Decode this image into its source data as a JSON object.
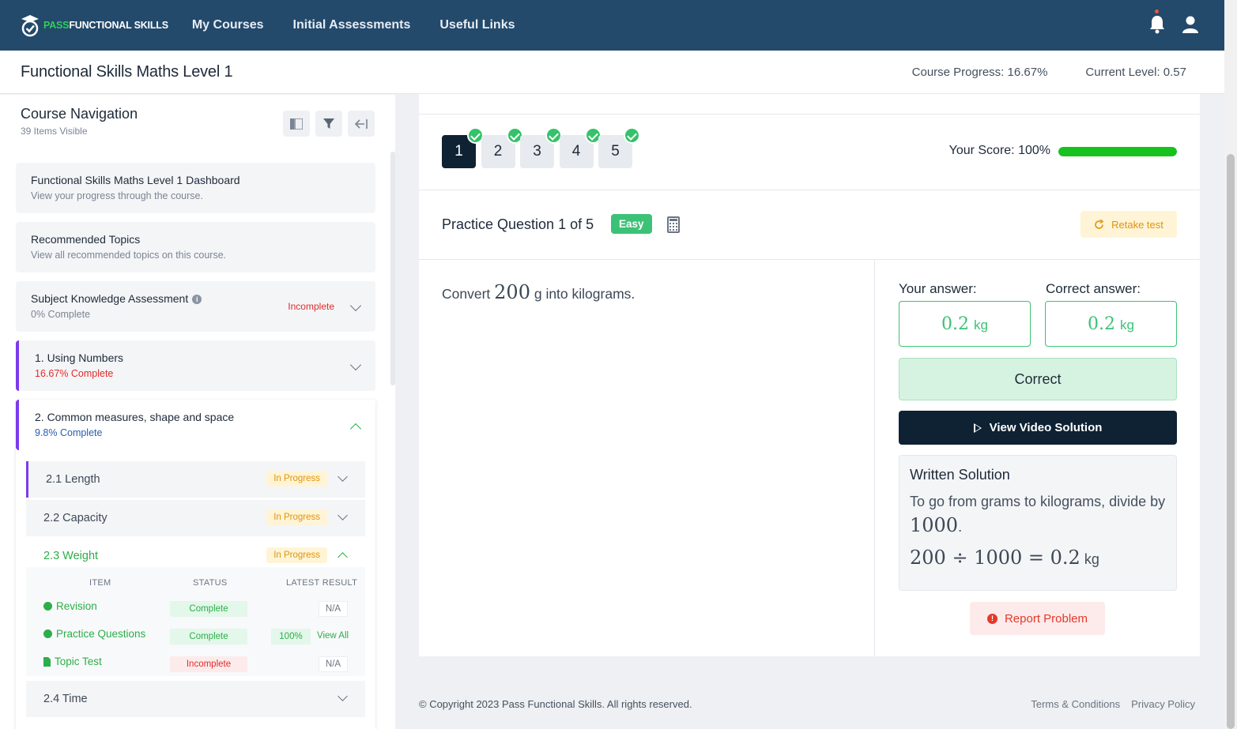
{
  "nav": {
    "logo_pass": "PASS",
    "logo_rest": "FUNCTIONAL SKILLS",
    "links": [
      "My Courses",
      "Initial Assessments",
      "Useful Links"
    ]
  },
  "header": {
    "course_title": "Functional Skills Maths Level 1",
    "progress_label": "Course Progress:",
    "progress_value": "16.67%",
    "level_label": "Current Level:",
    "level_value": "0.57"
  },
  "sidebar": {
    "title": "Course Navigation",
    "subtitle": "39 Items Visible",
    "cards": [
      {
        "title": "Functional Skills Maths Level 1 Dashboard",
        "sub": "View your progress through the course."
      },
      {
        "title": "Recommended Topics",
        "sub": "View all recommended topics on this course."
      },
      {
        "title": "Subject Knowledge Assessment",
        "sub": "0% Complete",
        "status": "Incomplete"
      },
      {
        "title": "1. Using Numbers",
        "sub": "16.67% Complete"
      },
      {
        "title": "2. Common measures, shape and space",
        "sub": "9.8% Complete"
      }
    ],
    "subitems": [
      {
        "label": "2.1 Length",
        "status": "In Progress"
      },
      {
        "label": "2.2 Capacity",
        "status": "In Progress"
      },
      {
        "label": "2.3 Weight",
        "status": "In Progress"
      },
      {
        "label": "2.4 Time"
      }
    ],
    "table": {
      "headers": [
        "ITEM",
        "STATUS",
        "LATEST RESULT"
      ],
      "rows": [
        {
          "name": "Revision",
          "status": "Complete",
          "result": "N/A"
        },
        {
          "name": "Practice Questions",
          "status": "Complete",
          "result": "100%",
          "link": "View All"
        },
        {
          "name": "Topic Test",
          "status": "Incomplete",
          "result": "N/A"
        }
      ]
    }
  },
  "main": {
    "tabs": [
      "1",
      "2",
      "3",
      "4",
      "5"
    ],
    "score_label": "Your Score: 100%",
    "score_fraction": 1.0,
    "question_title": "Practice Question 1 of 5",
    "difficulty": "Easy",
    "retake_label": "Retake test",
    "question_pre": "Convert",
    "question_num": "200",
    "question_post": "g into kilograms.",
    "your_answer_label": "Your answer:",
    "correct_answer_label": "Correct answer:",
    "your_answer_value": "0.2",
    "correct_answer_value": "0.2",
    "unit": "kg",
    "result": "Correct",
    "video_label": "View Video Solution",
    "ws_title": "Written Solution",
    "ws_text_pre": "To go from grams to kilograms, divide by",
    "ws_text_num": "1000",
    "ws_eq": "200 ÷ 1000 = 0.2",
    "ws_eq_unit": "kg",
    "report_label": "Report Problem"
  },
  "footer": {
    "copyright": "© Copyright 2023 Pass Functional Skills. All rights reserved.",
    "terms": "Terms & Conditions",
    "privacy": "Privacy Policy"
  },
  "colors": {
    "nav_bg": "#23496b",
    "accent_green": "#3cc276",
    "dark": "#0e2233",
    "purple": "#7c3aed"
  }
}
